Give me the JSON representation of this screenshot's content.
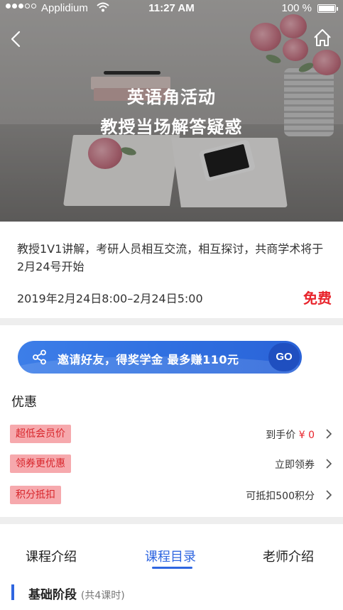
{
  "status_bar": {
    "carrier": "Applidium",
    "time": "11:27 AM",
    "battery": "100 %"
  },
  "hero": {
    "title_line1": "英语角活动",
    "title_line2": "教授当场解答疑惑"
  },
  "event": {
    "description": "教授1V1讲解，考研人员相互交流，相互探讨，共商学术将于2月24号开始",
    "time": "2019年2月24日8:00–2月24日5:00",
    "price": "免费"
  },
  "invite": {
    "text": "邀请好友，得奖学金 最多赚110元",
    "button": "GO"
  },
  "discounts": {
    "title": "优惠",
    "rows": [
      {
        "tag": "超低会员价",
        "value_prefix": "到手价 ",
        "value_accent": "¥ 0"
      },
      {
        "tag": "领券更优惠",
        "value_prefix": "立即领券",
        "value_accent": ""
      },
      {
        "tag": "积分抵扣",
        "value_prefix": "可抵扣500积分",
        "value_accent": ""
      }
    ]
  },
  "tabs": {
    "items": [
      "课程介绍",
      "课程目录",
      "老师介绍"
    ],
    "active": "课程目录"
  },
  "stage": {
    "name": "基础阶段",
    "count": "(共4课时)"
  },
  "colors": {
    "accent_blue": "#2f66e0",
    "price_red": "#e8242c",
    "tag_pink": "#f6a9ad"
  },
  "icons": [
    "back-icon",
    "home-icon",
    "share-icon",
    "chevron-right-icon",
    "wifi-icon",
    "battery-icon"
  ]
}
